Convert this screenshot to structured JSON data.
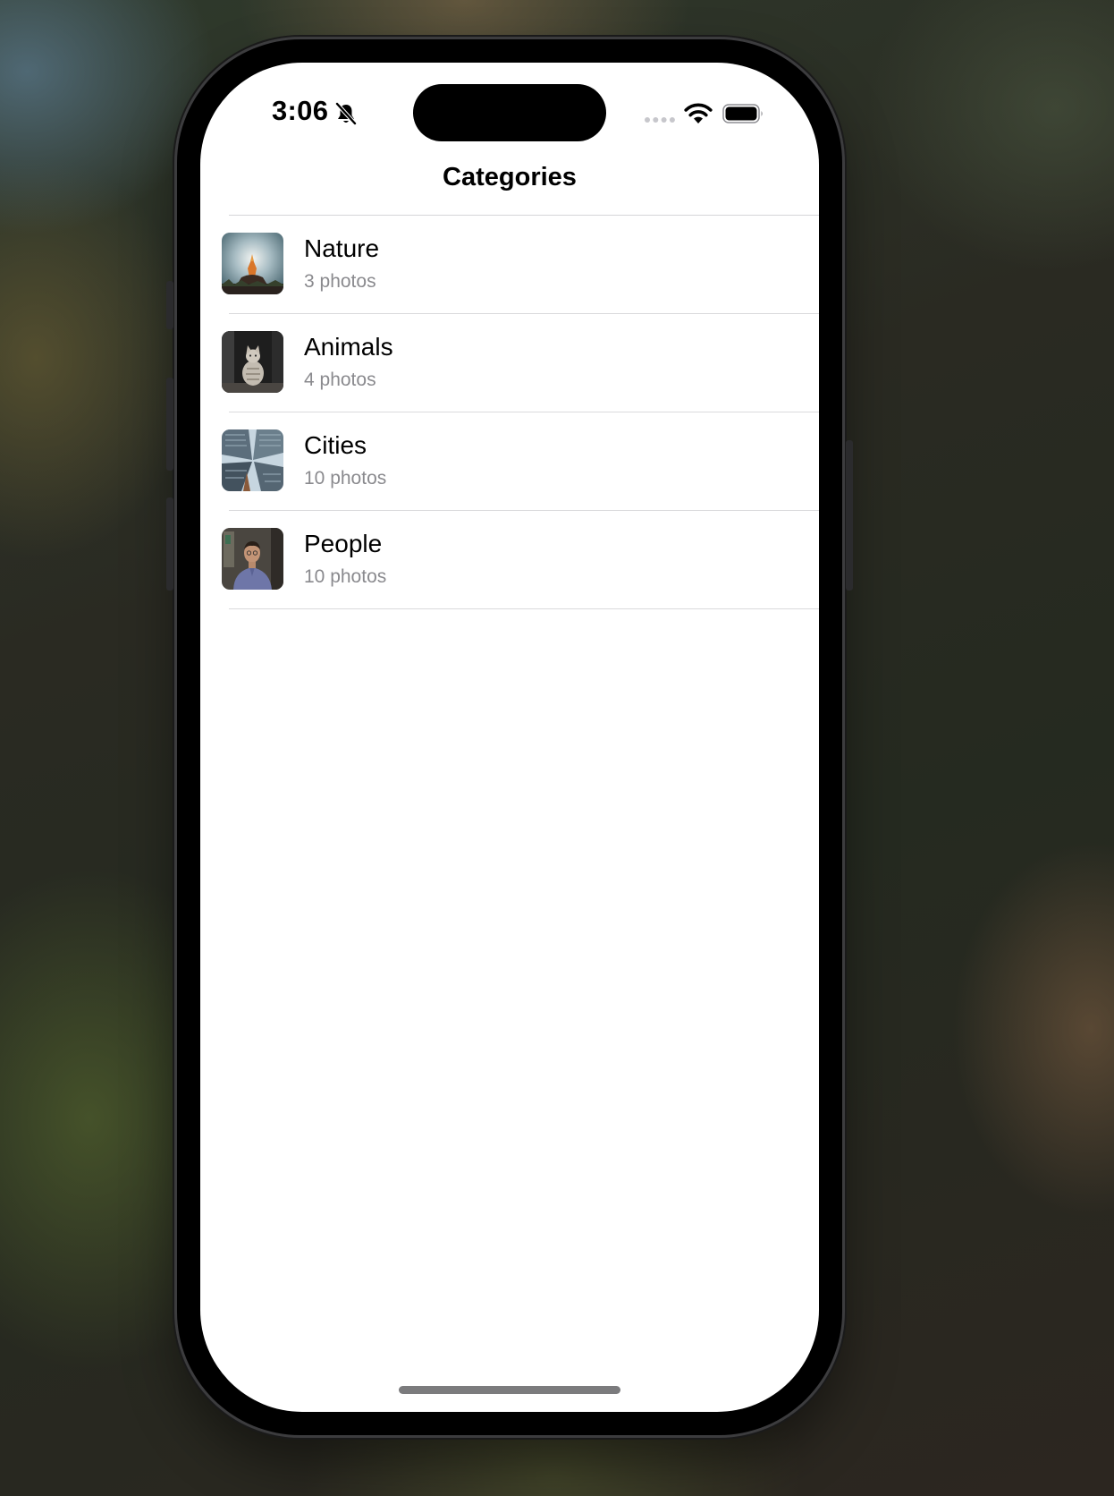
{
  "status_bar": {
    "time": "3:06",
    "icons": [
      "bell-slash-icon",
      "cellular-signal-icon",
      "wifi-icon",
      "battery-icon"
    ]
  },
  "nav": {
    "title": "Categories"
  },
  "categories": [
    {
      "name": "Nature",
      "count": "3 photos",
      "thumbnail": "nature-thumbnail"
    },
    {
      "name": "Animals",
      "count": "4 photos",
      "thumbnail": "cat-thumbnail"
    },
    {
      "name": "Cities",
      "count": "10 photos",
      "thumbnail": "skyscrapers-thumbnail"
    },
    {
      "name": "People",
      "count": "10 photos",
      "thumbnail": "person-thumbnail"
    }
  ],
  "colors": {
    "background": "#ffffff",
    "primary_text": "#000000",
    "secondary_text": "#8a8a8e",
    "separator": "#dadadc"
  }
}
